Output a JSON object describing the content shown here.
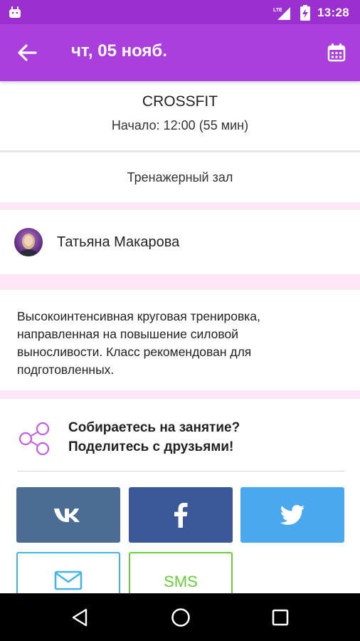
{
  "status_bar": {
    "time": "13:28",
    "network": "LTE",
    "icons": [
      "android-icon",
      "lte-signal-icon",
      "battery-charging-icon"
    ],
    "color": "#9b2fcf"
  },
  "app_bar": {
    "title": "чт, 05 нояб.",
    "back_icon": "arrow-back-icon",
    "calendar_icon": "calendar-icon",
    "color": "#ab3fdd"
  },
  "class_info": {
    "name": "CROSSFIT",
    "start": "Начало: 12:00 (55 мин)"
  },
  "room": {
    "name": "Тренажерный зал"
  },
  "trainer": {
    "name": "Татьяна Макарова"
  },
  "description": {
    "lines": [
      "Высокоинтенсивная круговая тренировка,",
      "направленная на повышение силовой",
      "выносливости. Класс рекомендован для",
      "подготовленных."
    ]
  },
  "share": {
    "title_line1": "Собираетесь на занятие?",
    "title_line2": "Поделитесь с друзьями!",
    "icon": "share-nodes-icon",
    "buttons": {
      "vk": {
        "icon": "vk-icon",
        "color": "#4b6c93"
      },
      "facebook": {
        "icon": "facebook-icon",
        "color": "#3b5998"
      },
      "twitter": {
        "icon": "twitter-icon",
        "color": "#4aa8ee"
      },
      "email": {
        "icon": "envelope-icon",
        "color": "#46b6e0"
      },
      "sms": {
        "label": "SMS",
        "color": "#6ccb3c"
      }
    }
  },
  "nav_bar": {
    "icons": [
      "nav-back-icon",
      "nav-home-icon",
      "nav-recents-icon"
    ]
  },
  "colors": {
    "accent_pink_band": "#fde6f5"
  }
}
